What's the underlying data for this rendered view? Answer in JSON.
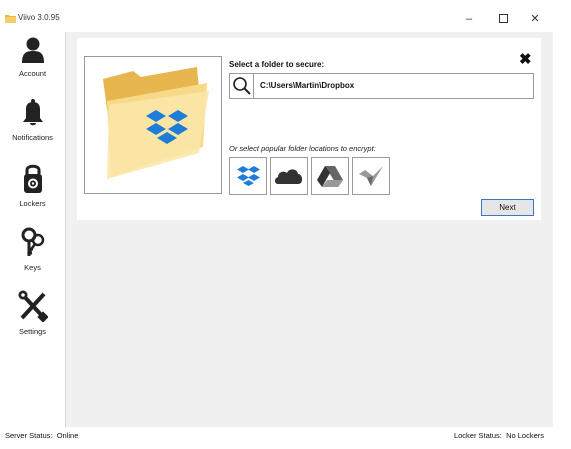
{
  "window": {
    "title": "Viivo 3.0.95",
    "minimize_glyph": "–",
    "maximize_glyph": "☐",
    "close_glyph": "✕"
  },
  "sidebar": {
    "items": [
      {
        "label": "Account",
        "icon": "account-icon"
      },
      {
        "label": "Notifications",
        "icon": "bell-icon"
      },
      {
        "label": "Lockers",
        "icon": "lock-icon"
      },
      {
        "label": "Keys",
        "icon": "keys-icon"
      },
      {
        "label": "Settings",
        "icon": "settings-icon"
      }
    ]
  },
  "panel": {
    "select_title": "Select a folder to secure:",
    "path_value": "C:\\Users\\Martin\\Dropbox",
    "popular_label": "Or select popular folder locations to encrypt:",
    "services": [
      "dropbox-icon",
      "onedrive-icon",
      "google-drive-icon",
      "copy-icon"
    ],
    "next_label": "Next",
    "close_glyph": "✖"
  },
  "status": {
    "server_label": "Server Status:",
    "server_value": "Online",
    "locker_label": "Locker Status:",
    "locker_value": "No Lockers"
  },
  "colors": {
    "dropbox_blue": "#1e7dd8",
    "folder_yellow": "#f2c35a",
    "accent_border": "#3a76c5"
  }
}
